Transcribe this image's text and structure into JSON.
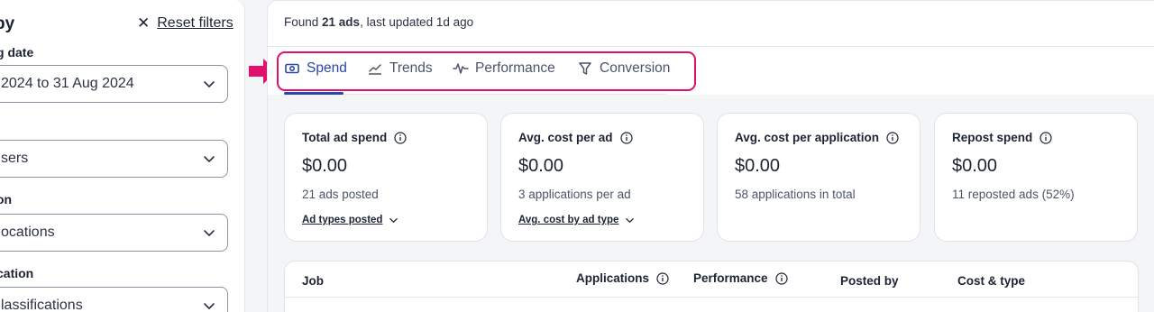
{
  "filters": {
    "title": "by",
    "reset_label": "Reset filters",
    "posting_date": {
      "label": "g date",
      "value": "2024 to 31 Aug 2024"
    },
    "users": {
      "label": "",
      "value": "sers"
    },
    "location": {
      "label": "on",
      "value": "ocations"
    },
    "classification": {
      "label": "cation",
      "value": "lassifications"
    }
  },
  "summary": {
    "prefix": "Found ",
    "count": "21 ads",
    "suffix": ", last updated 1d ago"
  },
  "tabs": [
    {
      "label": "Spend",
      "icon": "cash-icon",
      "active": true
    },
    {
      "label": "Trends",
      "icon": "trend-icon",
      "active": false
    },
    {
      "label": "Performance",
      "icon": "pulse-icon",
      "active": false
    },
    {
      "label": "Conversion",
      "icon": "funnel-icon",
      "active": false
    }
  ],
  "cards": [
    {
      "title": "Total ad spend",
      "value": "$0.00",
      "sub": "21 ads posted",
      "link": "Ad types posted"
    },
    {
      "title": "Avg. cost per ad",
      "value": "$0.00",
      "sub": "3 applications per ad",
      "link": "Avg. cost by ad type"
    },
    {
      "title": "Avg. cost per application",
      "value": "$0.00",
      "sub": "58 applications in total",
      "link": ""
    },
    {
      "title": "Repost spend",
      "value": "$0.00",
      "sub": "11 reposted ads (52%)",
      "link": ""
    }
  ],
  "table": {
    "headers": [
      "Job",
      "Applications",
      "Performance",
      "Posted by",
      "Cost & type"
    ]
  },
  "colors": {
    "accent": "#2947a8",
    "highlight": "#e0106e"
  }
}
